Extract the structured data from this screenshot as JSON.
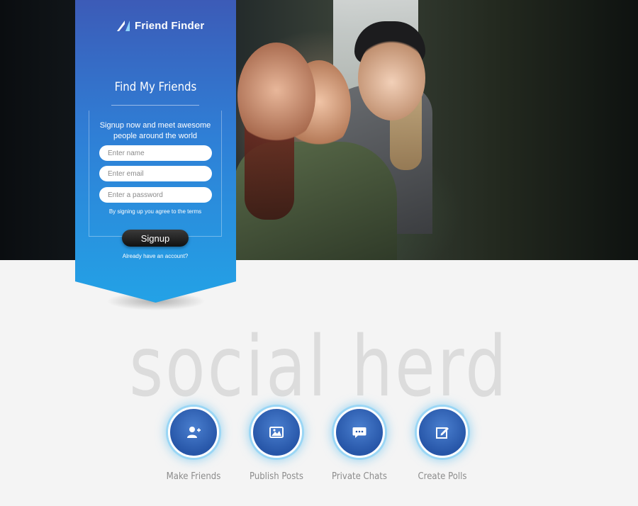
{
  "brand": {
    "name": "Friend Finder",
    "logo_icon": "friend-finder-logo-icon"
  },
  "signup": {
    "title": "Find My Friends",
    "intro": "Signup now and meet awesome people around the world",
    "fields": {
      "name_placeholder": "Enter name",
      "email_placeholder": "Enter email",
      "password_placeholder": "Enter a password"
    },
    "terms": "By signing up you agree to the terms",
    "button_label": "Signup",
    "have_account_link": "Already have an account?"
  },
  "tagline": "social herd",
  "features": [
    {
      "label": "Make Friends",
      "icon": "add-user-icon"
    },
    {
      "label": "Publish Posts",
      "icon": "image-icon"
    },
    {
      "label": "Private Chats",
      "icon": "chat-bubble-icon"
    },
    {
      "label": "Create Polls",
      "icon": "edit-icon"
    }
  ],
  "colors": {
    "panel_top": "#3c5bb7",
    "panel_bottom": "#23a2e6",
    "button": "#1a1a1a",
    "feature_circle": "#2756a8",
    "glow": "#9ad6f5"
  }
}
